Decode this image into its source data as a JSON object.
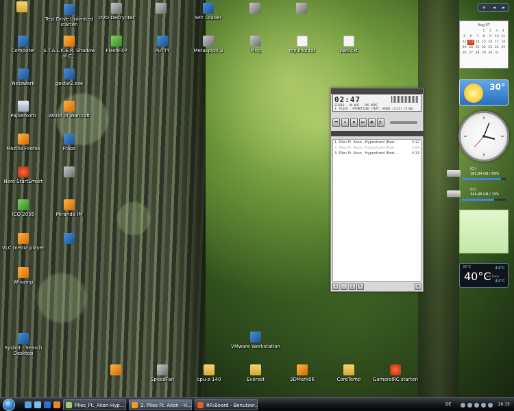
{
  "desktop_icons": [
    {
      "label": "",
      "kind": "folder"
    },
    {
      "label": "Test Drive Unlimited starten",
      "kind": "app"
    },
    {
      "label": "DVD Decrypter",
      "kind": "app"
    },
    {
      "label": "",
      "kind": "app"
    },
    {
      "label": "SFT Loader",
      "kind": "app"
    },
    {
      "label": "",
      "kind": "app"
    },
    {
      "label": "",
      "kind": "app"
    },
    {
      "label": "Computer",
      "kind": "app"
    },
    {
      "label": "S.T.A.L.K.E.R. Shadow of C...",
      "kind": "app"
    },
    {
      "label": "FlashFXP",
      "kind": "green"
    },
    {
      "label": "PuTTY",
      "kind": "app"
    },
    {
      "label": "Metasploit 3",
      "kind": "app"
    },
    {
      "label": "Ping",
      "kind": "gray"
    },
    {
      "label": "mylinks.txt",
      "kind": "file"
    },
    {
      "label": "pwd.txt",
      "kind": "file"
    },
    {
      "label": "Netzwerk",
      "kind": "app"
    },
    {
      "label": "gektw2.exe",
      "kind": "app"
    },
    {
      "label": "Papierkorb",
      "kind": "bin"
    },
    {
      "label": "World of Warcraft",
      "kind": "orange"
    },
    {
      "label": "Mozilla Firefox",
      "kind": "orange"
    },
    {
      "label": "Fraps",
      "kind": "app"
    },
    {
      "label": "Nero StartSmart",
      "kind": "red"
    },
    {
      "label": "",
      "kind": "app"
    },
    {
      "label": "ICQ 2005",
      "kind": "green"
    },
    {
      "label": "Miranda IM",
      "kind": "orange"
    },
    {
      "label": "VLC media player",
      "kind": "orange"
    },
    {
      "label": "",
      "kind": "app"
    },
    {
      "label": "Winamp",
      "kind": "orange"
    },
    {
      "label": "Sysbot - Search Desktop",
      "kind": "app"
    },
    {
      "label": "VMware Workstation",
      "kind": "app"
    },
    {
      "label": "",
      "kind": "orange"
    },
    {
      "label": "SpeedFan",
      "kind": "gray"
    },
    {
      "label": "cpu-z-140",
      "kind": "folder"
    },
    {
      "label": "Everest",
      "kind": "folder"
    },
    {
      "label": "3DMark06",
      "kind": "orange"
    },
    {
      "label": "CoreTemp",
      "kind": "folder"
    },
    {
      "label": "GamersIRC starten",
      "kind": "red"
    }
  ],
  "player": {
    "time": "02:47",
    "info": "STEREO - 44 KHZ - 256 KBPS",
    "track": "3. PLIES - HYPNOTIZED (FEAT. AKON) (4:13) (3:06)",
    "controls": [
      "⏮",
      "⏸",
      "⏹",
      "⏭",
      "⏏",
      "🔊"
    ],
    "playlist": [
      {
        "title": "1. Plies Ft. Akon - Hypnotized (Feat...",
        "len": "3:12",
        "dim": false
      },
      {
        "title": "2. Plies Ft. Akon - Hypnotized (Feat...",
        "len": "3:06",
        "dim": true
      },
      {
        "title": "3. Plies Ft. Akon - Hypnotized (Feat...",
        "len": "4:13",
        "dim": false
      }
    ],
    "bottom_buttons": [
      "+",
      "−",
      "▯",
      "✎",
      "≡"
    ]
  },
  "sidebar": {
    "header_buttons": [
      "+",
      "◂",
      "▸"
    ],
    "calendar": {
      "month": "Aug 07",
      "days": [
        "",
        "",
        "",
        "1",
        "2",
        "3",
        "4",
        "5",
        "6",
        "7",
        "8",
        "9",
        "10",
        "11",
        "12",
        "13",
        "14",
        "15",
        "16",
        "17",
        "18",
        "19",
        "20",
        "21",
        "22",
        "23",
        "24",
        "25",
        "26",
        "27",
        "28",
        "29",
        "30",
        "31",
        ""
      ],
      "today": "13"
    },
    "weather": {
      "temp": "30°"
    },
    "drives": [
      {
        "label": "(C:)",
        "stats": "181,84 GB / 89%",
        "fill": 0.89
      },
      {
        "label": "(D:)",
        "stats": "344,98 GB / 74%",
        "fill": 0.74
      }
    ],
    "cpu_temp": {
      "main": "40°C",
      "core1": "44°C",
      "core2": "44°C",
      "label": "30°C",
      "sub": "Core Temp"
    }
  },
  "taskbar": {
    "tasks": [
      {
        "label": "Plies_Ft._Akon-Hyp...",
        "active": false
      },
      {
        "label": "2. Plies Ft. Akon - H...",
        "active": true
      },
      {
        "label": "RR:Board - Benutzer...",
        "active": false
      }
    ],
    "language": "DE",
    "clock": "20:15"
  }
}
